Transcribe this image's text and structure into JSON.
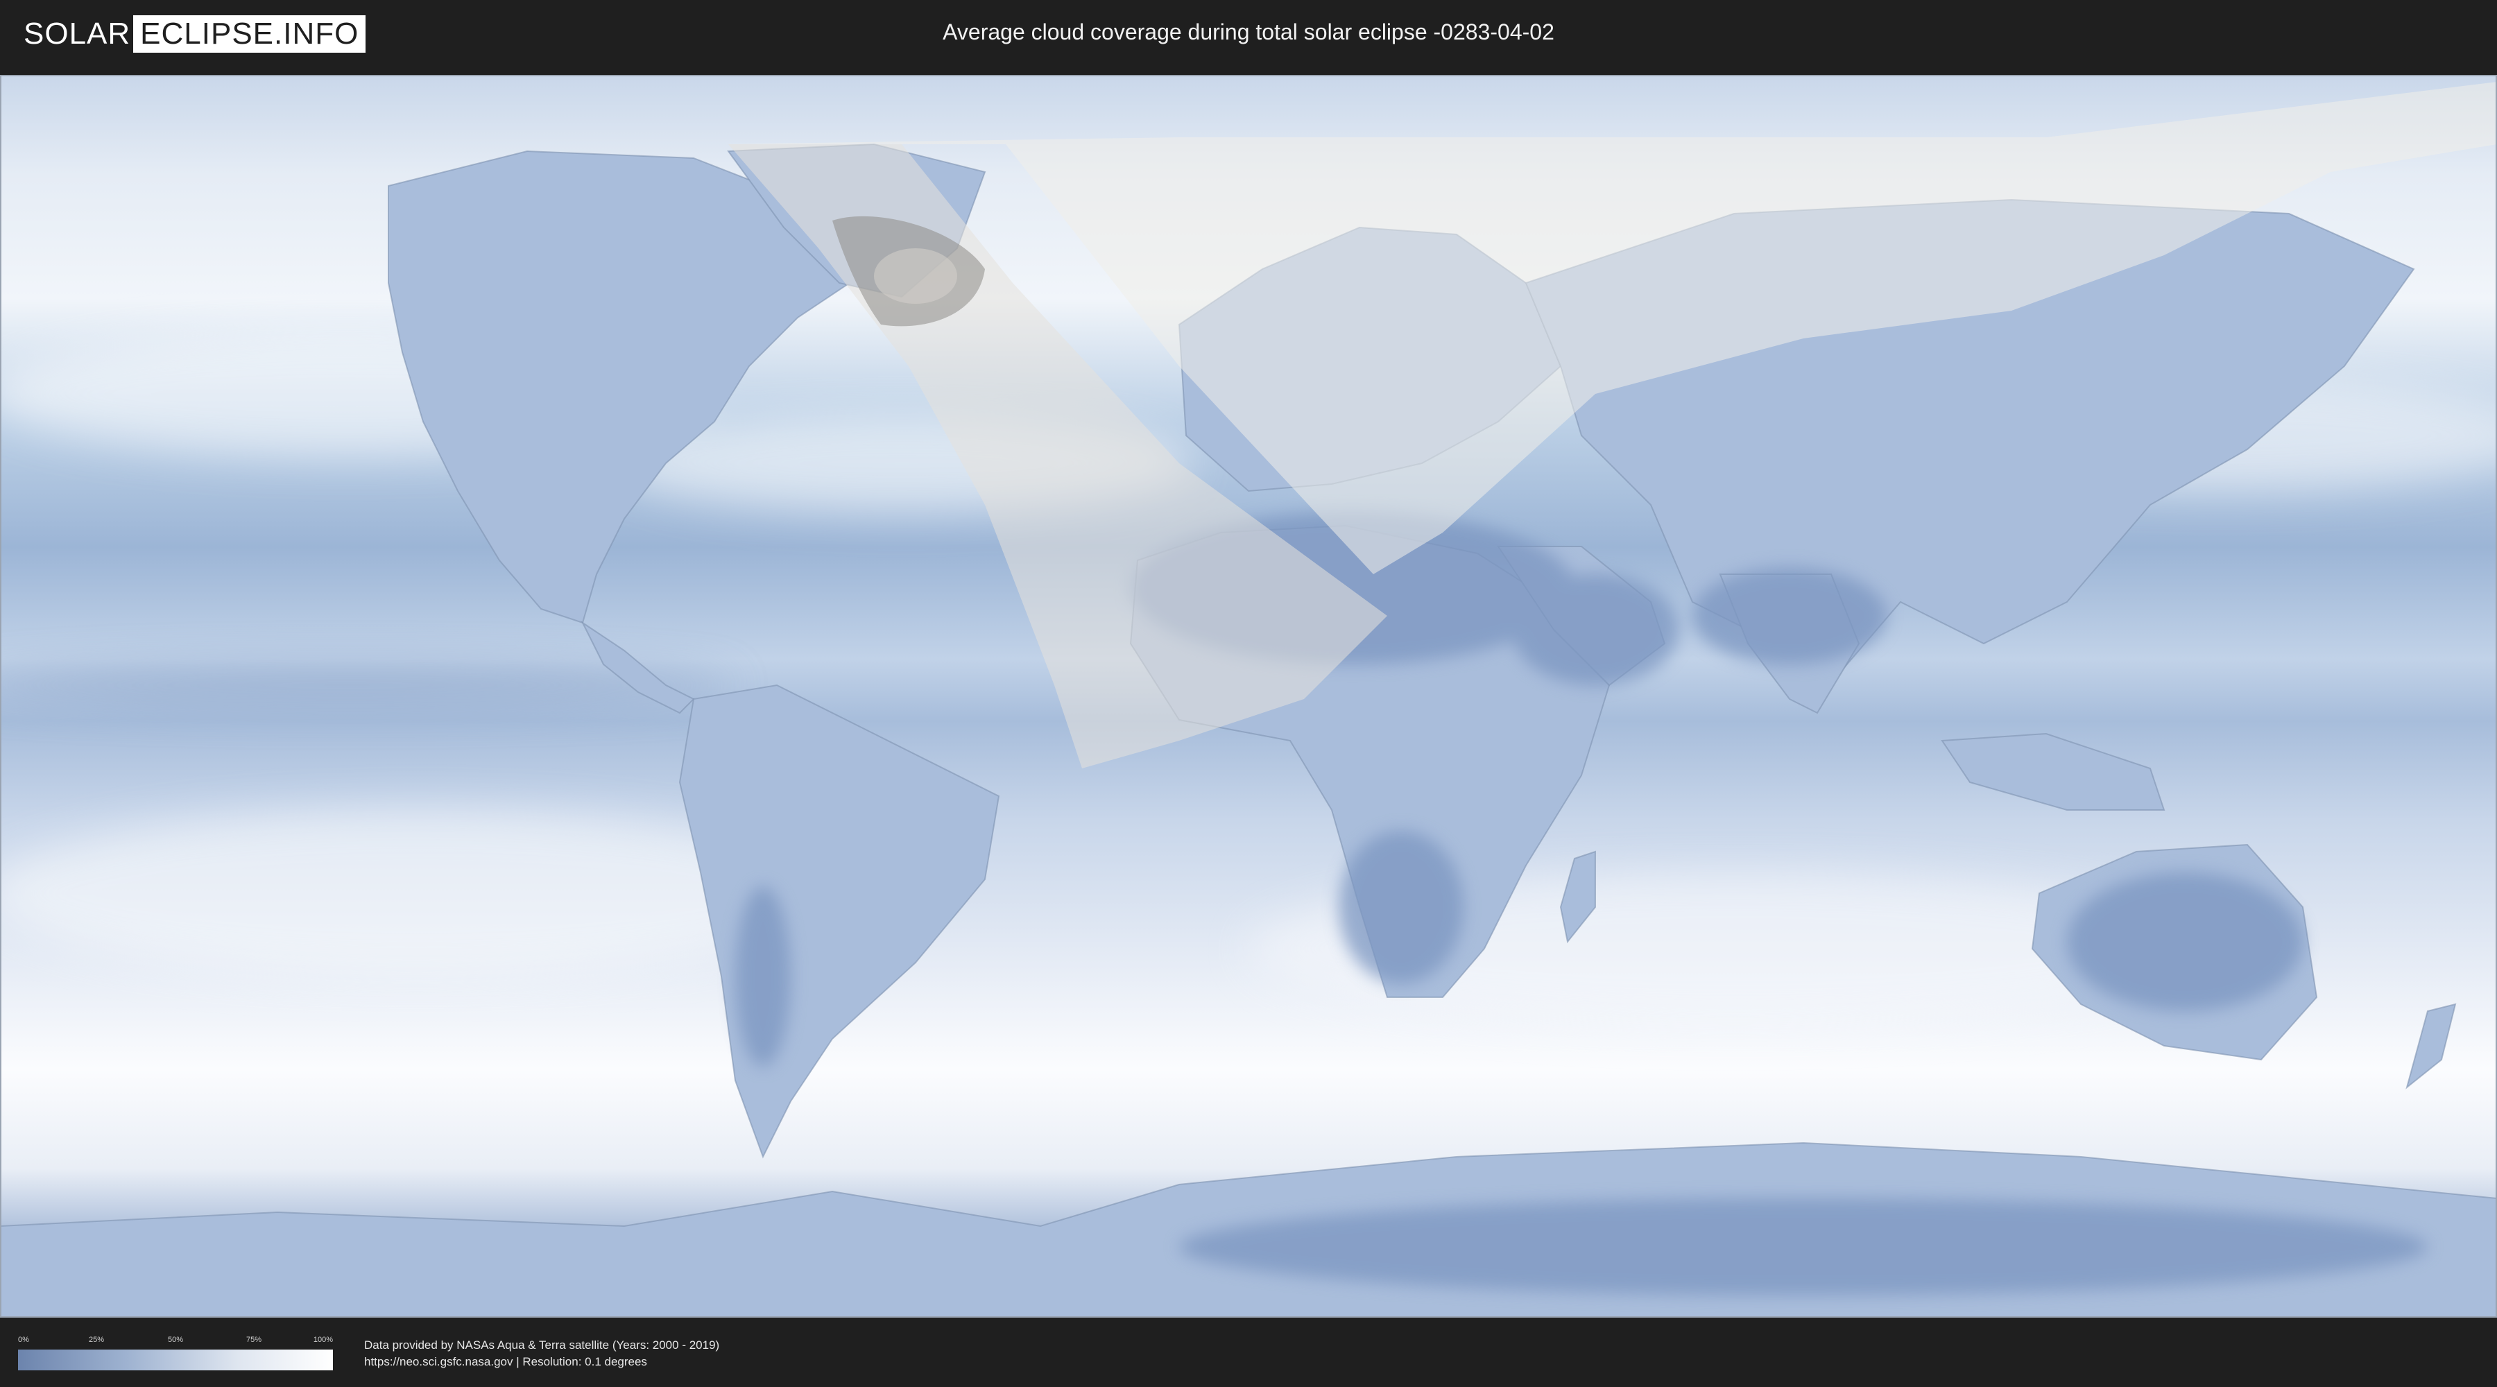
{
  "header": {
    "logo_left": "SOLAR",
    "logo_right": "ECLIPSE.INFO",
    "title": "Average cloud coverage during total solar eclipse -0283-04-02"
  },
  "legend": {
    "ticks": [
      "0%",
      "25%",
      "50%",
      "75%",
      "100%"
    ],
    "colors": [
      "#6c84ad",
      "#9fb3d1",
      "#dfe6f0",
      "#ffffff"
    ]
  },
  "footer": {
    "credit_line1": "Data provided by NASAs Aqua & Terra satellite (Years: 2000 - 2019)",
    "credit_line2": "https://neo.sci.gsfc.nasa.gov | Resolution: 0.1 degrees"
  },
  "map": {
    "projection": "equirectangular",
    "overlay": "eclipse-visibility-region",
    "palette": {
      "ocean_clear": "#8fa9cc",
      "cloudy": "#f4f7fb",
      "land_dry": "#7d97c0",
      "border": "#6d7f9a"
    }
  }
}
